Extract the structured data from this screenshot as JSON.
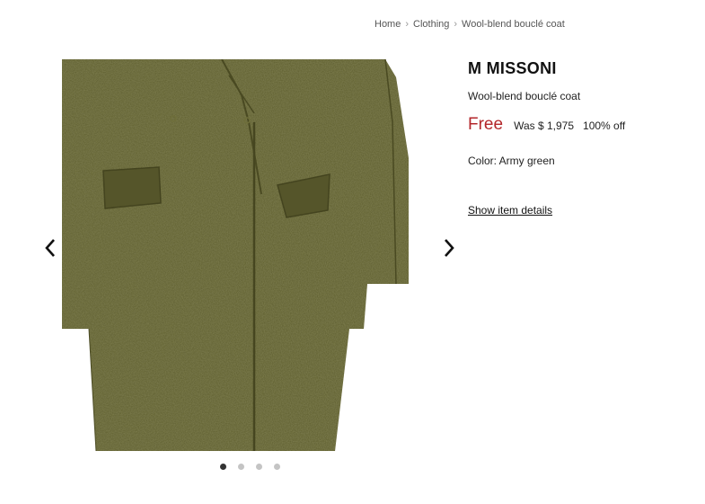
{
  "breadcrumb": {
    "items": [
      "Home",
      "Clothing",
      "Wool-blend bouclé coat"
    ],
    "separator": "›"
  },
  "product": {
    "brand": "M MISSONI",
    "name": "Wool-blend bouclé coat",
    "price": "Free",
    "was_price": "Was $ 1,975",
    "discount": "100% off",
    "color_label": "Color: Army green",
    "details_link": "Show item details"
  },
  "gallery": {
    "image": "army-green-boucle-coat-photo",
    "prev_icon": "chevron-left-icon",
    "next_icon": "chevron-right-icon",
    "slides_total": 4,
    "active_slide": 1
  },
  "colors": {
    "price_red": "#b3262a",
    "coat_green": "#5a5a2b",
    "dot_active": "#333333",
    "dot_inactive": "#c4c4c4"
  }
}
